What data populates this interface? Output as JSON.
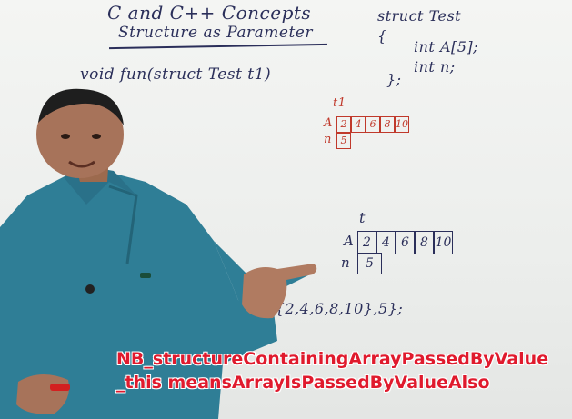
{
  "board": {
    "title": "C and C++ Concepts",
    "subtitle": "Structure as Parameter",
    "struct_decl": "struct Test",
    "brace_open": "{",
    "member_a": "int A[5];",
    "member_n": "int n;",
    "brace_close": "};",
    "func_sig": "void fun(struct Test t1)",
    "t1_label": "t1",
    "t1_a_label": "A",
    "t1_n_label": "n",
    "t1_values": [
      "2",
      "4",
      "6",
      "8",
      "10"
    ],
    "t1_n_value": "5",
    "t_label": "t",
    "t_a_label": "A",
    "t_n_label": "n",
    "t_values": [
      "2",
      "4",
      "6",
      "8",
      "10"
    ],
    "t_n_value": "5",
    "init_expr": "Test t={{2,4,6,8,10},5};"
  },
  "caption": "NB_structureContainingArrayPassedByValue_this meansArrayIsPassedByValueAlso",
  "colors": {
    "marker_blue": "#2b2f5a",
    "marker_red": "#c0392b",
    "caption_red": "#e01a2d",
    "shirt_teal": "#2f7e96"
  }
}
